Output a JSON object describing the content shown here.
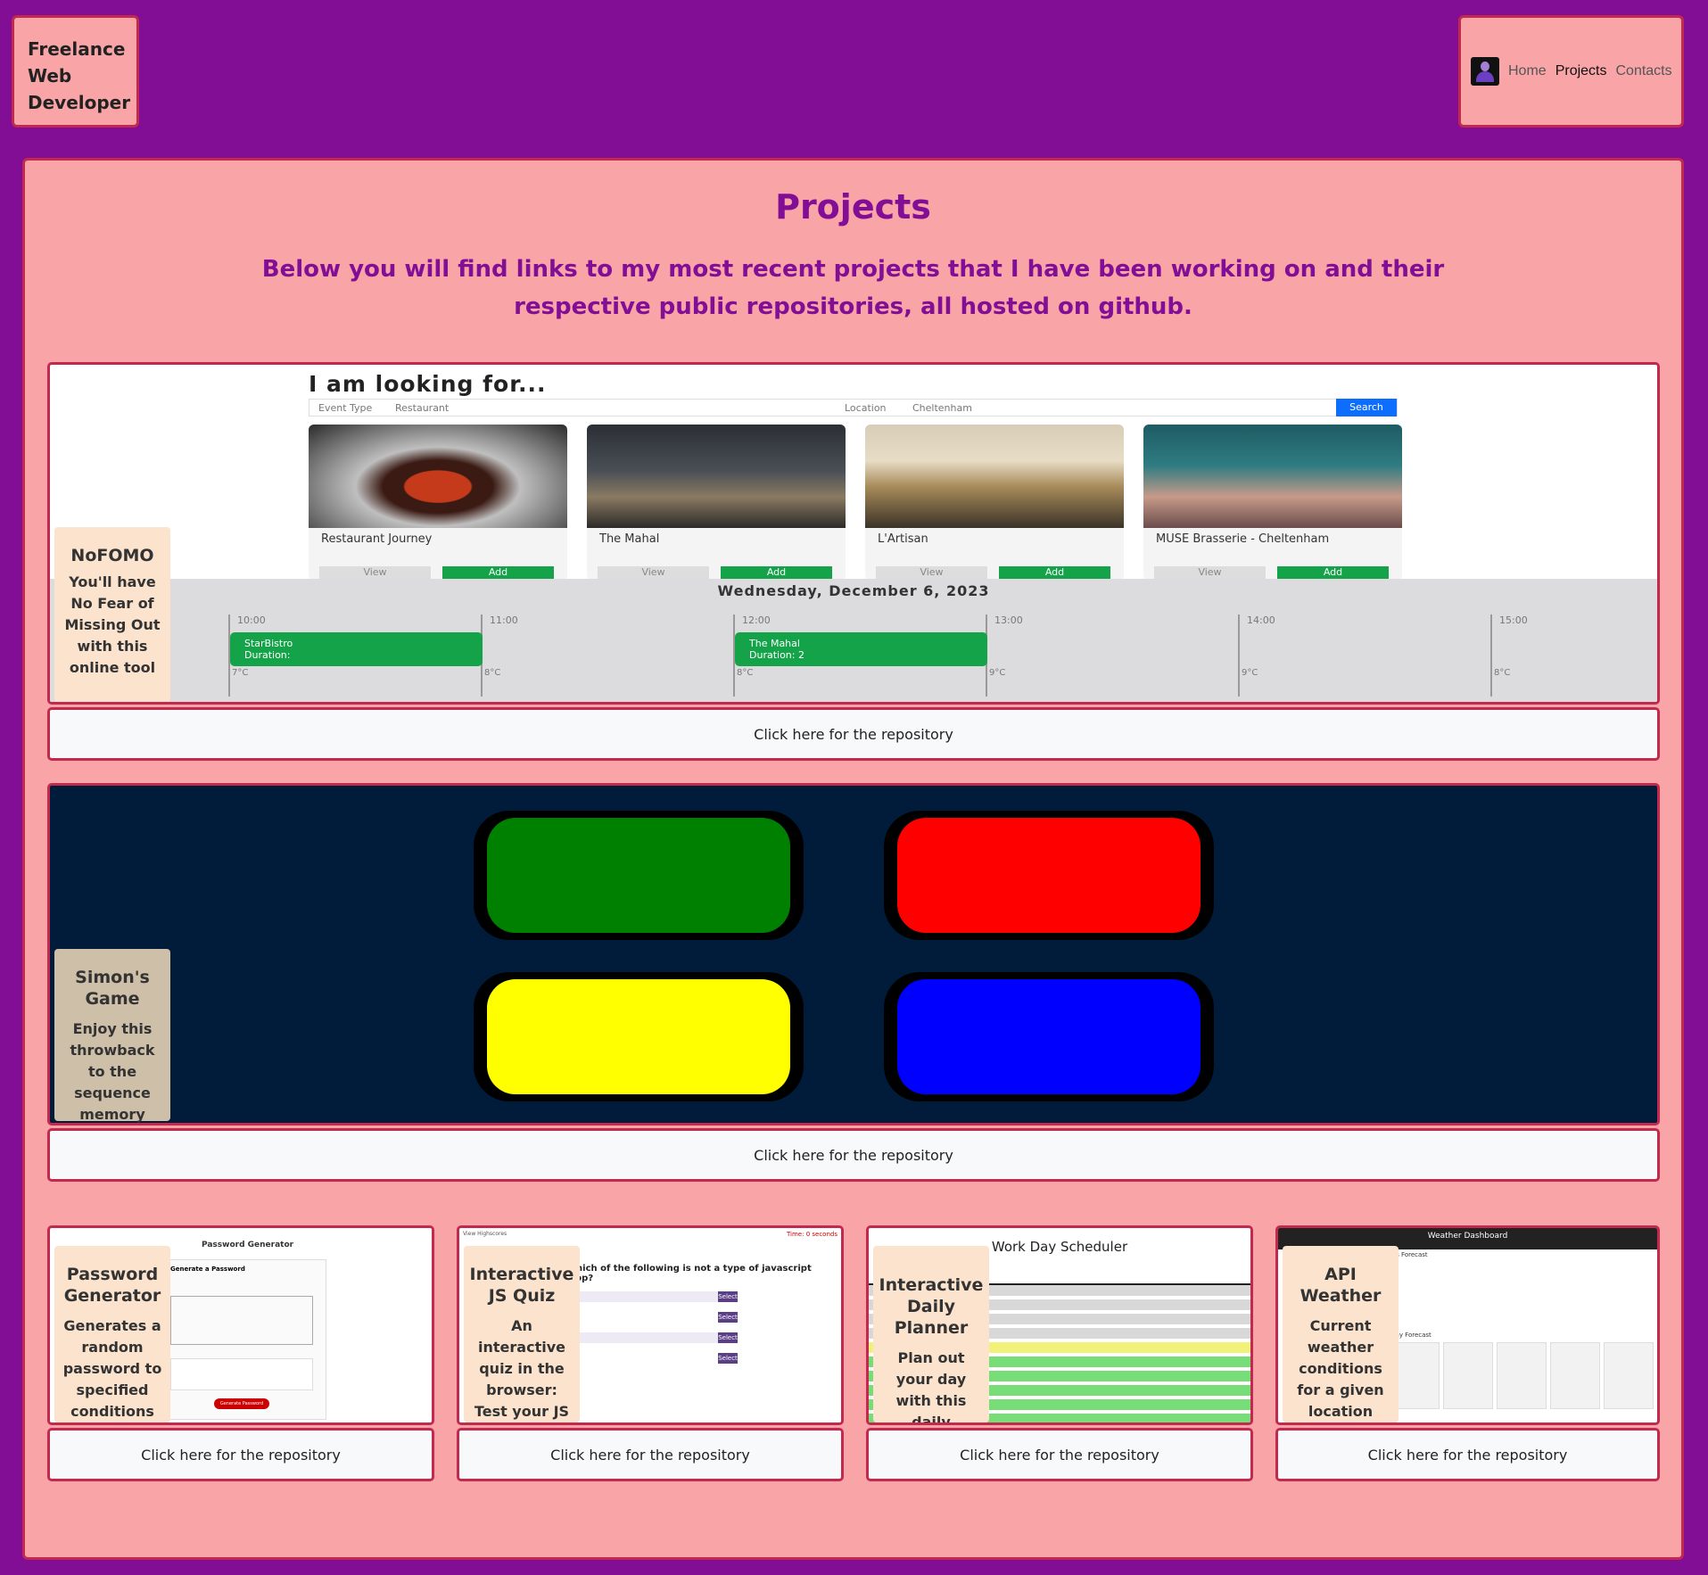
{
  "brand": {
    "line1": "Freelance",
    "line2": "Web",
    "line3": "Developer"
  },
  "nav": {
    "items": [
      "Home",
      "Projects",
      "Contacts"
    ],
    "active": "Projects"
  },
  "page": {
    "title": "Projects",
    "intro": "Below you will find links to my most recent projects that I have been working on and their respective public repositories, all hosted on github."
  },
  "projects": [
    {
      "name": "NoFOMO",
      "description": "You'll have No Fear of Missing Out with this online tool",
      "repo_label": "Click here for the repository",
      "preview": {
        "heading": "I am looking for...",
        "event_type_label": "Event Type",
        "event_type_value": "Restaurant",
        "location_label": "Location",
        "location_value": "Cheltenham",
        "search_label": "Search",
        "cards": [
          "Restaurant Journey",
          "The Mahal",
          "L'Artisan",
          "MUSE Brasserie - Cheltenham"
        ],
        "view_label": "View",
        "add_label": "Add",
        "date": "Wednesday, December 6, 2023",
        "hours": [
          "10:00",
          "11:00",
          "12:00",
          "13:00",
          "14:00",
          "15:00"
        ],
        "temps": [
          "7°C",
          "8°C",
          "8°C",
          "9°C",
          "9°C",
          "8°C"
        ],
        "events": [
          {
            "name": "StarBistro",
            "duration": "Duration:"
          },
          {
            "name": "The Mahal",
            "duration": "Duration: 2"
          }
        ]
      }
    },
    {
      "name": "Simon's Game",
      "description": "Enjoy this throwback to the sequence memory game",
      "repo_label": "Click here for the repository"
    },
    {
      "name": "Password Generator",
      "description": "Generates a random password to specified conditions",
      "repo_label": "Click here for the repository",
      "preview": {
        "heading": "Password Generator",
        "subheading": "Generate a Password",
        "button": "Generate Password"
      }
    },
    {
      "name": "Interactive JS Quiz",
      "description": "An interactive quiz in the browser: Test your JS knowledge!",
      "repo_label": "Click here for the repository",
      "preview": {
        "question": "Which of the following is not a type of javascript loop?",
        "select_label": "Select",
        "time_label": "Time: 0 seconds",
        "highscores": "View Highscores"
      }
    },
    {
      "name": "Interactive Daily Planner",
      "description": "Plan out your day with this daily planner",
      "repo_label": "Click here for the repository",
      "preview": {
        "heading": "Work Day Scheduler"
      }
    },
    {
      "name": "API Weather",
      "description": "Current weather conditions for a given location",
      "repo_label": "Click here for the repository",
      "preview": {
        "heading": "Weather Dashboard",
        "today": "Today's Forecast",
        "five_day": "Five Day Forecast"
      }
    }
  ],
  "colors": {
    "background": "#820e96",
    "panel": "#f9a4a6",
    "border": "#c2294f",
    "heading": "#820e96",
    "simon_green": "#008000",
    "simon_red": "#ff0000",
    "simon_yellow": "#ffff00",
    "simon_blue": "#0000ff",
    "simon_bg": "#011b3b"
  },
  "icons": {
    "nav_logo": "user-silhouette-icon"
  }
}
